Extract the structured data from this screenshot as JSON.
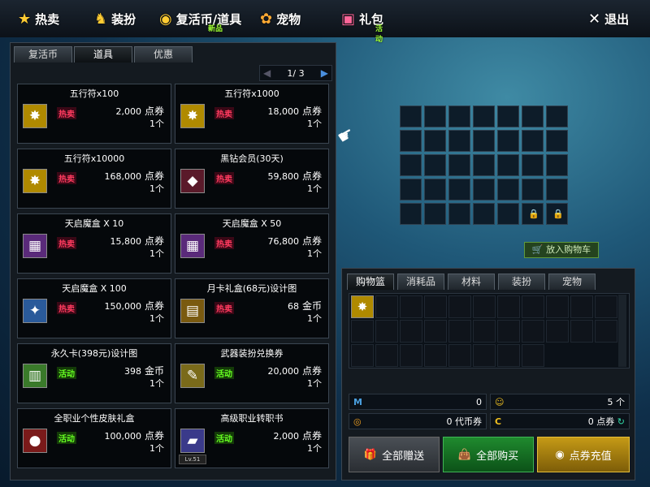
{
  "topbar": {
    "hot": {
      "icon": "★",
      "label": "热卖"
    },
    "outfit": {
      "icon": "♞",
      "label": "装扮"
    },
    "revive": {
      "icon": "◉",
      "label": "复活币/道具",
      "sub": "新品"
    },
    "pet": {
      "icon": "✿",
      "label": "宠物"
    },
    "gift": {
      "icon": "▣",
      "label": "礼包",
      "sub": "活动"
    },
    "exit": {
      "icon": "✕",
      "label": "退出"
    }
  },
  "left_tabs": [
    "复活币",
    "道具",
    "优惠"
  ],
  "pager": {
    "prev": "◀",
    "text": "1/ 3",
    "next": "▶"
  },
  "items": [
    {
      "title": "五行符x100",
      "icon": "✸",
      "badge": "热卖",
      "price": "2,000",
      "unit": "点券",
      "qty": "1个"
    },
    {
      "title": "五行符x1000",
      "icon": "✸",
      "badge": "热卖",
      "price": "18,000",
      "unit": "点券",
      "qty": "1个"
    },
    {
      "title": "五行符x10000",
      "icon": "✸",
      "badge": "热卖",
      "price": "168,000",
      "unit": "点券",
      "qty": "1个"
    },
    {
      "title": "黑钻会员(30天)",
      "icon": "◆",
      "badge": "热卖",
      "price": "59,800",
      "unit": "点券",
      "qty": "1个"
    },
    {
      "title": "天启魔盒 X 10",
      "icon": "▦",
      "badge": "热卖",
      "price": "15,800",
      "unit": "点券",
      "qty": "1个"
    },
    {
      "title": "天启魔盒 X 50",
      "icon": "▦",
      "badge": "热卖",
      "price": "76,800",
      "unit": "点券",
      "qty": "1个"
    },
    {
      "title": "天启魔盒 X 100",
      "icon": "✦",
      "badge": "热卖",
      "price": "150,000",
      "unit": "点券",
      "qty": "1个"
    },
    {
      "title": "月卡礼盒(68元)设计图",
      "icon": "▤",
      "badge": "热卖",
      "price": "68",
      "unit": "金币",
      "qty": "1个"
    },
    {
      "title": "永久卡(398元)设计图",
      "icon": "▥",
      "badge": "活动",
      "price": "398",
      "unit": "金币",
      "qty": "1个"
    },
    {
      "title": "武器装扮兑换券",
      "icon": "✎",
      "badge": "活动",
      "price": "20,000",
      "unit": "点券",
      "qty": "1个"
    },
    {
      "title": "全职业个性皮肤礼盒",
      "icon": "●",
      "badge": "活动",
      "price": "100,000",
      "unit": "点券",
      "qty": "1个"
    },
    {
      "title": "高级职业转职书",
      "icon": "▰",
      "badge": "活动",
      "price": "2,000",
      "unit": "点券",
      "qty": "1个",
      "level": "Lv.51"
    }
  ],
  "pointer_icon": "☛",
  "lock_icon": "🔒",
  "add_cart": {
    "icon": "🛒",
    "label": "放入购物车"
  },
  "right_tabs": [
    "购物篮",
    "消耗品",
    "材料",
    "装扮",
    "宠物"
  ],
  "basket_first_icon": "✸",
  "summary": {
    "m": {
      "icon": "M",
      "value": "0"
    },
    "coin": {
      "icon": "☺",
      "value": "5",
      "unit": "个"
    },
    "dai": {
      "icon": "◎",
      "value": "0",
      "unit": "代币券"
    },
    "dian": {
      "icon": "C",
      "value": "0",
      "unit": "点券",
      "refresh": "↻"
    }
  },
  "buttons": {
    "gift_all": {
      "icon": "🎁",
      "label": "全部赠送"
    },
    "buy_all": {
      "icon": "👜",
      "label": "全部购买"
    },
    "recharge": {
      "icon": "◉",
      "label": "点券充值"
    }
  }
}
